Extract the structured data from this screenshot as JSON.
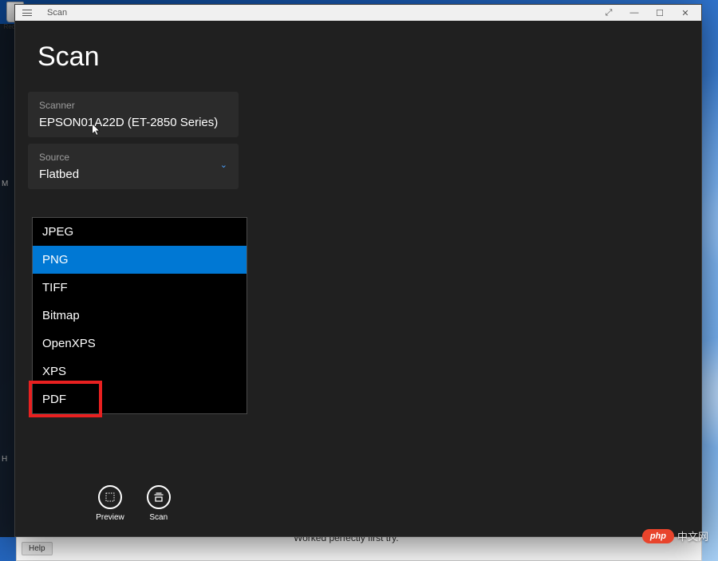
{
  "desktop": {
    "recycle_label": "Recyc..."
  },
  "window": {
    "title": "Scan",
    "app_title": "Scan"
  },
  "titlebar_buttons": {
    "expand": "⤢",
    "minimize": "—",
    "maximize": "☐",
    "close": "✕"
  },
  "fields": {
    "scanner": {
      "label": "Scanner",
      "value": "EPSON01A22D (ET-2850 Series)"
    },
    "source": {
      "label": "Source",
      "value": "Flatbed"
    }
  },
  "dropdown": {
    "options": [
      {
        "label": "JPEG",
        "selected": false
      },
      {
        "label": "PNG",
        "selected": true
      },
      {
        "label": "TIFF",
        "selected": false
      },
      {
        "label": "Bitmap",
        "selected": false
      },
      {
        "label": "OpenXPS",
        "selected": false
      },
      {
        "label": "XPS",
        "selected": false
      },
      {
        "label": "PDF",
        "selected": false
      }
    ],
    "highlighted": "PDF"
  },
  "actions": {
    "preview": "Preview",
    "scan": "Scan"
  },
  "background": {
    "help": "Help",
    "review_snippet": "Worked perfectly first try.",
    "left_labels": [
      "M",
      "H"
    ]
  },
  "watermark": {
    "pill": "php",
    "text": "中文网"
  }
}
